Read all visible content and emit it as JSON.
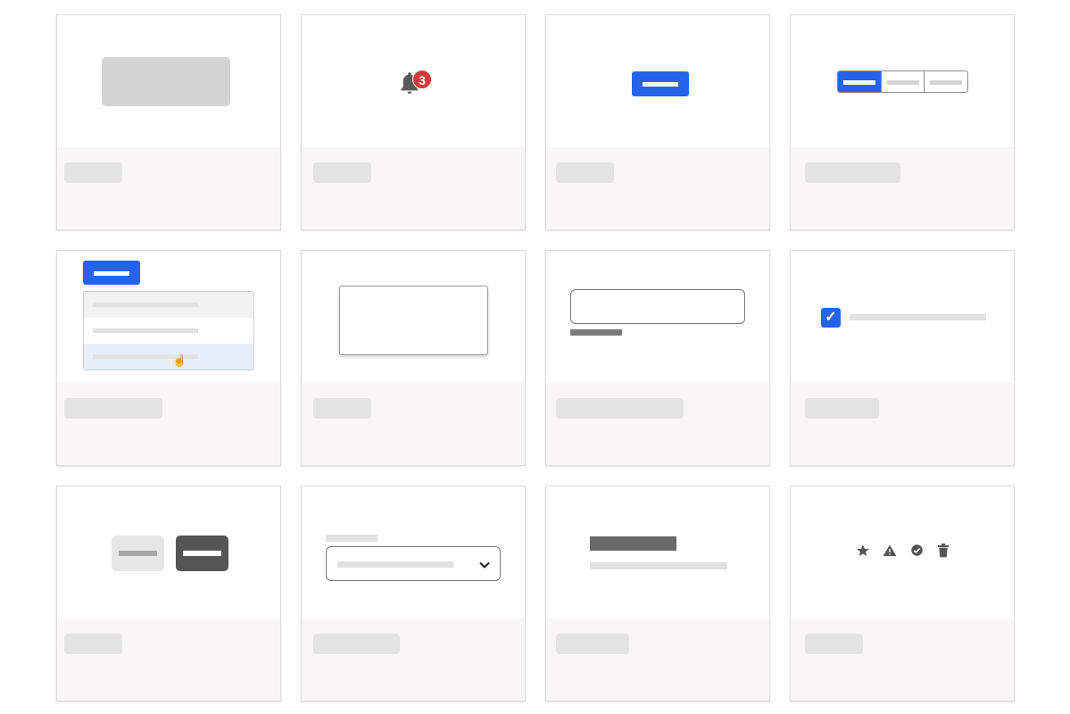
{
  "cards": [
    {
      "name": "placeholder",
      "title_skeleton": true
    },
    {
      "name": "notification",
      "badge_count": "3"
    },
    {
      "name": "primary-button"
    },
    {
      "name": "segmented-control"
    },
    {
      "name": "dropdown-menu"
    },
    {
      "name": "modal"
    },
    {
      "name": "text-input"
    },
    {
      "name": "checkbox",
      "checked": true
    },
    {
      "name": "buttons"
    },
    {
      "name": "select"
    },
    {
      "name": "text"
    },
    {
      "name": "icons",
      "icons": [
        "★",
        "▲",
        "✔",
        "🗑"
      ]
    }
  ],
  "colors": {
    "accent": "#2563eb",
    "badge": "#d23a3a",
    "footer_bg": "#f8f7f6",
    "skeleton": "#e3e3e3"
  },
  "icons": {
    "bell": "bell-icon",
    "star": "star-icon",
    "warning": "warning-icon",
    "check_circle": "check-circle-icon",
    "trash": "trash-icon",
    "checkbox_check": "check-icon",
    "cursor": "hand-cursor-icon",
    "chevron": "chevron-down-icon"
  },
  "notification": {
    "badge": "3"
  },
  "checkbox": {
    "mark": "✓"
  },
  "select": {
    "chevron": "⌄"
  },
  "dropdown": {
    "cursor": "☝"
  },
  "icon_glyphs": {
    "star": "★",
    "warning": "▲",
    "check_circle": "✔",
    "trash": "🗑"
  }
}
